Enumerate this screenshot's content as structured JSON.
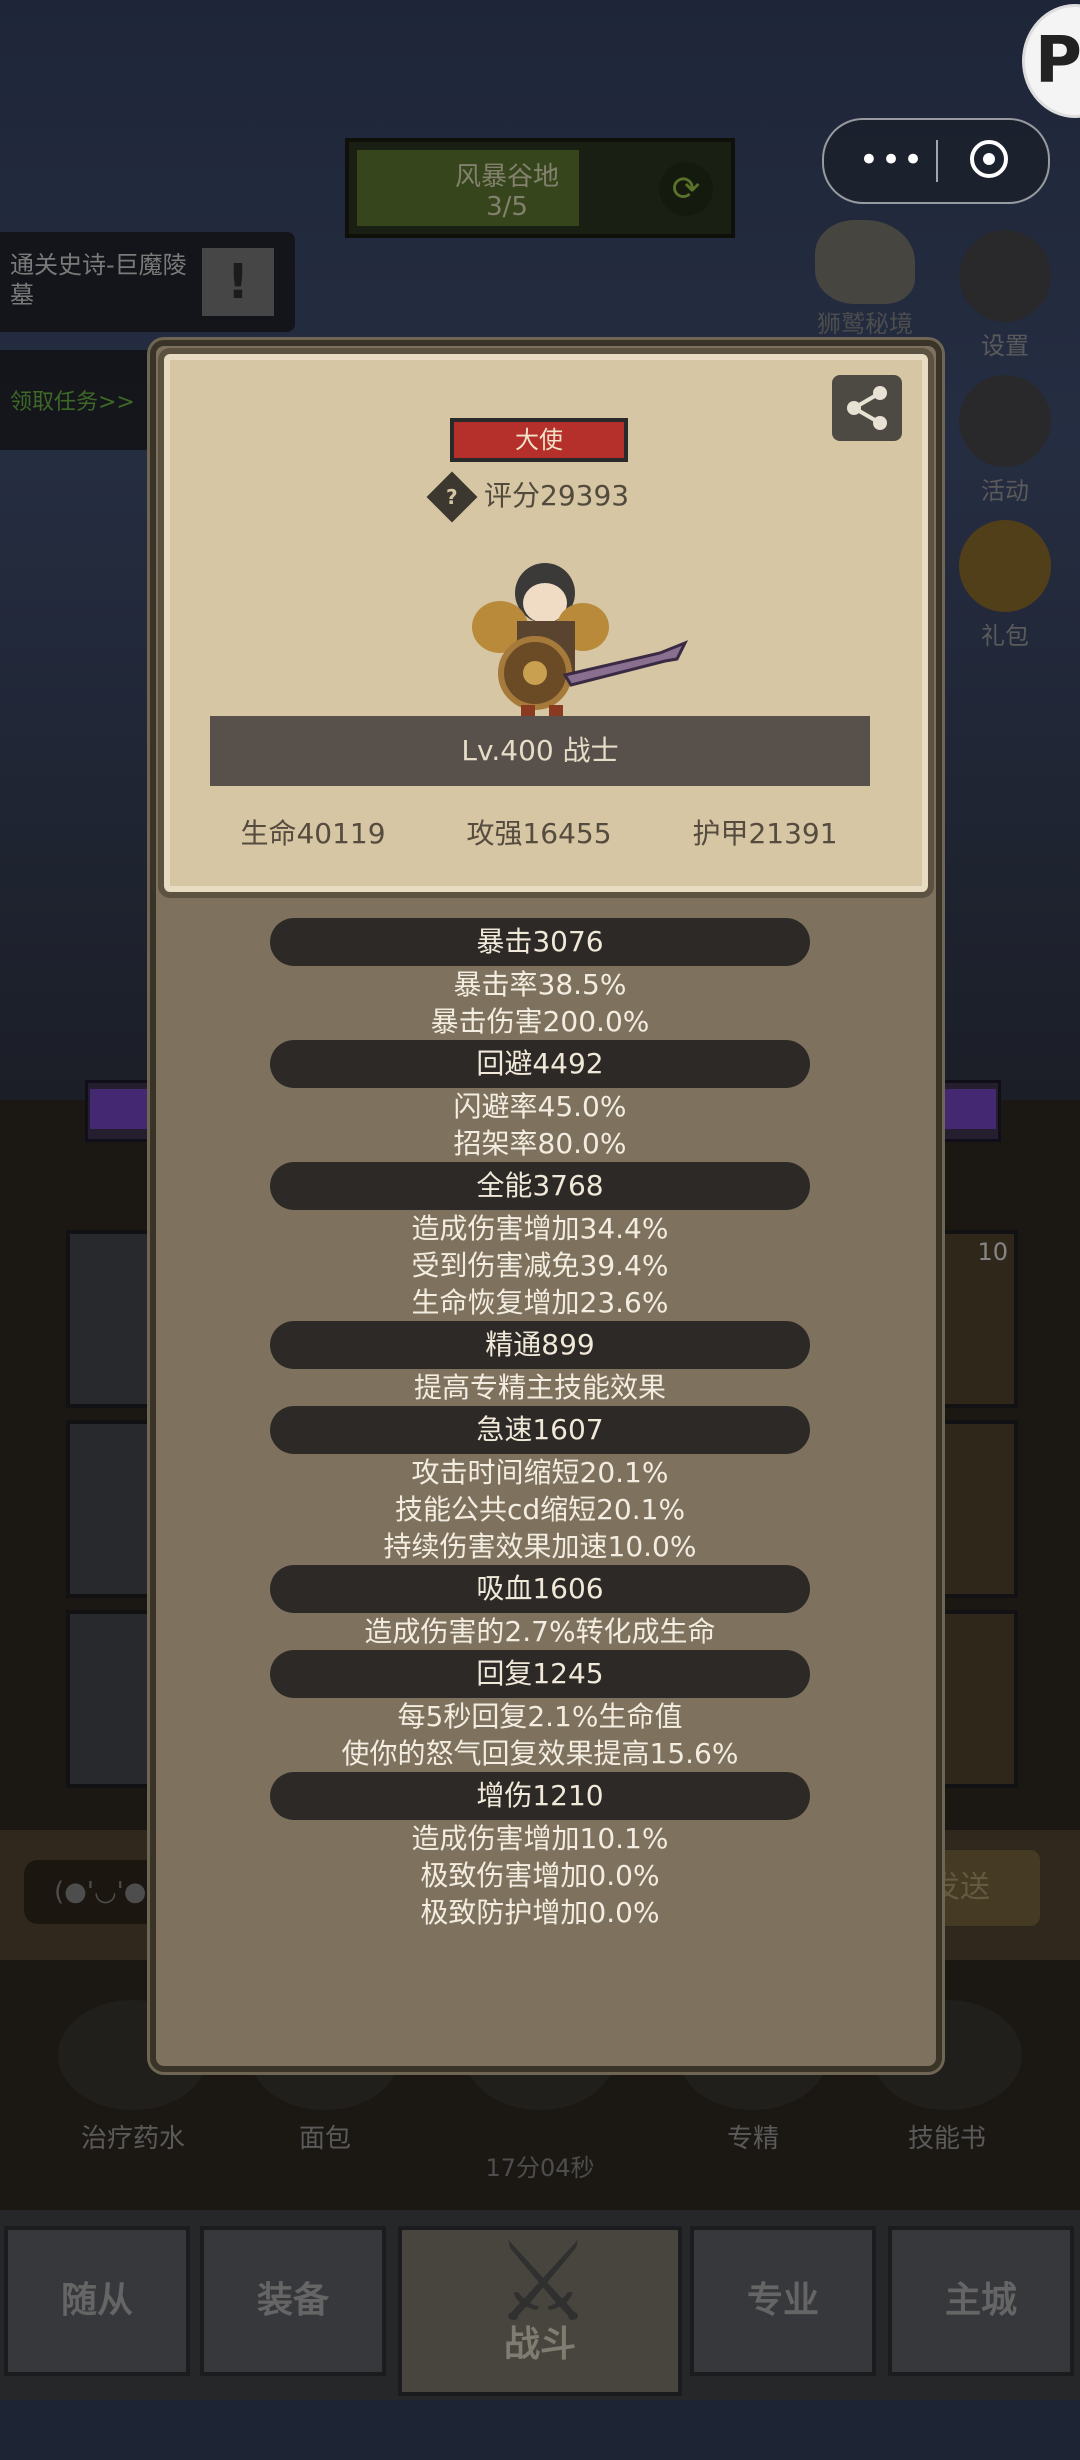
{
  "top": {
    "storm": {
      "name": "风暴谷地",
      "progress": "3/5",
      "progress_fraction": 0.6
    },
    "quest": {
      "title": "通关史诗-巨魔陵墓",
      "claim": "领取任务>>"
    },
    "capsule": {
      "more": "•••",
      "close": "◉"
    },
    "side_buttons": [
      {
        "label": "狮鹫秘境",
        "icon": "griffin-icon"
      },
      {
        "label": "设置",
        "icon": "gear-icon"
      },
      {
        "label": "活动",
        "icon": "calendar-icon"
      },
      {
        "label": "礼包",
        "icon": "gift-icon"
      }
    ],
    "slot_count": "10"
  },
  "panel": {
    "rank": "大使",
    "score": "评分29393",
    "level": "Lv.400 战士",
    "stats": {
      "hp": "生命40119",
      "attack": "攻强16455",
      "armor": "护甲21391"
    },
    "attributes": [
      {
        "head": "暴击3076",
        "lines": [
          "暴击率38.5%",
          "暴击伤害200.0%"
        ]
      },
      {
        "head": "回避4492",
        "lines": [
          "闪避率45.0%",
          "招架率80.0%"
        ]
      },
      {
        "head": "全能3768",
        "lines": [
          "造成伤害增加34.4%",
          "受到伤害减免39.4%",
          "生命恢复增加23.6%"
        ]
      },
      {
        "head": "精通899",
        "lines": [
          "提高专精主技能效果"
        ]
      },
      {
        "head": "急速1607",
        "lines": [
          "攻击时间缩短20.1%",
          "技能公共cd缩短20.1%",
          "持续伤害效果加速10.0%"
        ]
      },
      {
        "head": "吸血1606",
        "lines": [
          "造成伤害的2.7%转化成生命"
        ]
      },
      {
        "head": "回复1245",
        "lines": [
          "每5秒回复2.1%生命值",
          "使你的怒气回复效果提高15.6%"
        ]
      },
      {
        "head": "增伤1210",
        "lines": [
          "造成伤害增加10.1%",
          "极致伤害增加0.0%",
          "极致防护增加0.0%"
        ]
      }
    ]
  },
  "chat": {
    "emoji": "(●'◡'●",
    "send": "发送"
  },
  "items": [
    {
      "label": "治疗药水",
      "icon": "potion-icon"
    },
    {
      "label": "面包",
      "icon": "bread-icon"
    },
    {
      "label": "",
      "icon": "chest-icon"
    },
    {
      "label": "专精",
      "icon": "spec-icon"
    },
    {
      "label": "技能书",
      "icon": "book-icon"
    }
  ],
  "timer": "17分04秒",
  "nav": {
    "follower": "随从",
    "equipment": "装备",
    "battle": "战斗",
    "profession": "专业",
    "city": "主城"
  },
  "colors": {
    "rank_red": "#b5302a",
    "panel": "#7e725e",
    "card": "#d6c6a3",
    "bar_dark": "#2c2926"
  }
}
